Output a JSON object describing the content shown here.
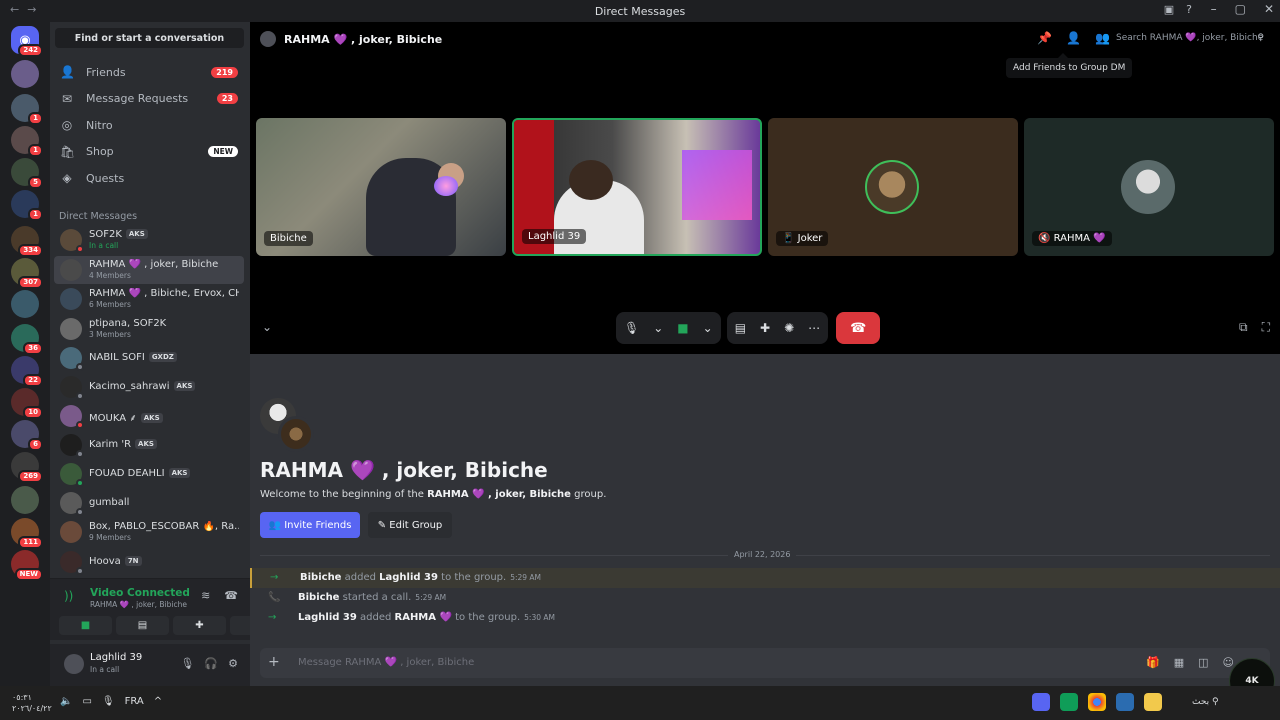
{
  "window": {
    "title": "Direct Messages"
  },
  "servers": {
    "home_badge": "242",
    "badges": [
      "",
      "1",
      "1",
      "5",
      "1",
      "334",
      "307",
      "",
      "36",
      "22",
      "10",
      "6",
      "269",
      "",
      "111",
      "NEW"
    ]
  },
  "sidebar": {
    "search_label": "Find or start a conversation",
    "nav": [
      {
        "label": "Friends",
        "count": "219",
        "icon": "friends-icon"
      },
      {
        "label": "Message Requests",
        "count": "23",
        "icon": "envelope-icon"
      },
      {
        "label": "Nitro",
        "count": "",
        "icon": "nitro-icon"
      },
      {
        "label": "Shop",
        "badge": "NEW",
        "icon": "shop-icon"
      },
      {
        "label": "Quests",
        "count": "",
        "icon": "quests-icon"
      }
    ],
    "dm_header": "Direct Messages",
    "dms": [
      {
        "name": "SOF2K",
        "tag": "AKS",
        "sub": "In a call",
        "sub_type": "call",
        "status": "dnd"
      },
      {
        "name": "RAHMA 💜 , joker, Bibiche",
        "tag": "",
        "sub": "4 Members",
        "sub_type": "members",
        "status": ""
      },
      {
        "name": "RAHMA 💜 , Bibiche, Ervox, CH...",
        "tag": "",
        "sub": "6 Members",
        "sub_type": "members",
        "status": ""
      },
      {
        "name": "ptipana, SOF2K",
        "tag": "",
        "sub": "3 Members",
        "sub_type": "members",
        "status": ""
      },
      {
        "name": "NABIL SOFI",
        "tag": "GXDZ",
        "sub": "",
        "sub_type": "",
        "status": "offline"
      },
      {
        "name": "Kacimo_sahrawi",
        "tag": "AKS",
        "sub": "",
        "sub_type": "",
        "status": "offline"
      },
      {
        "name": "MOUKA ⸙",
        "tag": "AKS",
        "sub": "",
        "sub_type": "",
        "status": "dnd"
      },
      {
        "name": "Karim 'R",
        "tag": "AKS",
        "sub": "",
        "sub_type": "",
        "status": "offline"
      },
      {
        "name": "FOUAD DEAHLI",
        "tag": "AKS",
        "sub": "",
        "sub_type": "",
        "status": "on"
      },
      {
        "name": "gumball",
        "tag": "",
        "sub": "",
        "sub_type": "",
        "status": "offline"
      },
      {
        "name": "Box, PABLO_ESCOBAR 🔥, Ra...",
        "tag": "",
        "sub": "9 Members",
        "sub_type": "members",
        "status": ""
      },
      {
        "name": "Hoova",
        "tag": "7N",
        "sub": "",
        "sub_type": "",
        "status": "offline"
      }
    ]
  },
  "voice": {
    "status": "Video Connected",
    "channel": "RAHMA 💜 , joker, Bibiche"
  },
  "user": {
    "name": "Laghlid 39",
    "status": "In a call"
  },
  "header": {
    "title": "RAHMA 💜 , joker, Bibiche",
    "search_placeholder": "Search RAHMA 💜, joker, Bibiche",
    "tooltip": "Add Friends to Group DM"
  },
  "tiles": [
    {
      "label": "Bibiche",
      "icon": ""
    },
    {
      "label": "Laghlid 39",
      "icon": ""
    },
    {
      "label": "Joker",
      "icon": "📱"
    },
    {
      "label": "RAHMA 💜",
      "icon": "🔇"
    }
  ],
  "welcome": {
    "title": "RAHMA 💜 , joker, Bibiche",
    "sub_prefix": "Welcome to the beginning of the ",
    "sub_name": "RAHMA 💜 , joker, Bibiche",
    "sub_suffix": " group.",
    "invite_label": "Invite Friends",
    "edit_label": "Edit Group"
  },
  "divider_date": "April 22, 2026",
  "messages": [
    {
      "actor": "Bibiche",
      "action": " added ",
      "target": "Laghlid 39",
      "rest": " to the group.",
      "time": "5:29 AM",
      "icon": "→",
      "highlight": true
    },
    {
      "actor": "Bibiche",
      "action": " started a call.",
      "target": "",
      "rest": "",
      "time": "5:29 AM",
      "icon": "📞",
      "highlight": false
    },
    {
      "actor": "Laghlid 39",
      "action": " added ",
      "target": "RAHMA 💜",
      "rest": " to the group.",
      "time": "5:30 AM",
      "icon": "→",
      "highlight": false
    }
  ],
  "composer": {
    "placeholder": "Message RAHMA 💜 , joker, Bibiche"
  },
  "taskbar": {
    "time": "٠٥:٣١",
    "date": "٢٠٢٦/٠٤/٢٢",
    "lang": "FRA",
    "search": "بحث"
  },
  "logo_text": "4K"
}
